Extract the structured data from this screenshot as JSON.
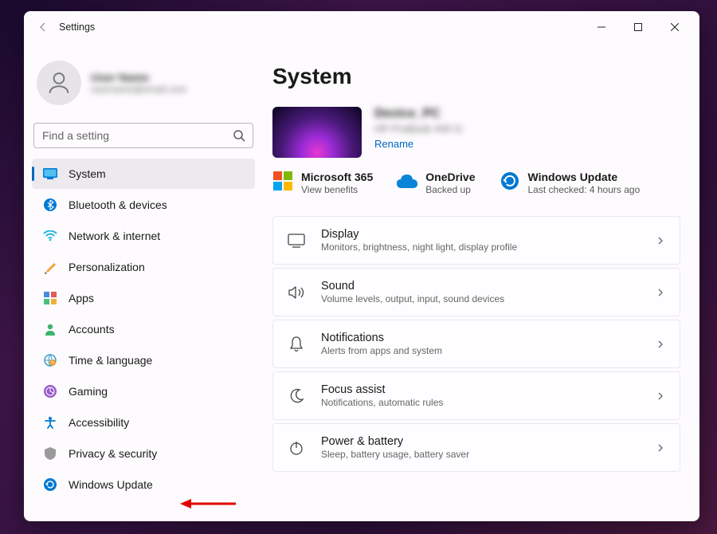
{
  "window": {
    "title": "Settings"
  },
  "user": {
    "name": "User Name",
    "email": "username@email.com"
  },
  "search": {
    "placeholder": "Find a setting"
  },
  "sidebar": {
    "items": [
      {
        "label": "System"
      },
      {
        "label": "Bluetooth & devices"
      },
      {
        "label": "Network & internet"
      },
      {
        "label": "Personalization"
      },
      {
        "label": "Apps"
      },
      {
        "label": "Accounts"
      },
      {
        "label": "Time & language"
      },
      {
        "label": "Gaming"
      },
      {
        "label": "Accessibility"
      },
      {
        "label": "Privacy & security"
      },
      {
        "label": "Windows Update"
      }
    ]
  },
  "page": {
    "title": "System",
    "device": {
      "name": "Device_PC",
      "model": "HP ProBook 440 G",
      "rename": "Rename"
    },
    "status": [
      {
        "title": "Microsoft 365",
        "sub": "View benefits"
      },
      {
        "title": "OneDrive",
        "sub": "Backed up"
      },
      {
        "title": "Windows Update",
        "sub": "Last checked: 4 hours ago"
      }
    ],
    "cards": [
      {
        "title": "Display",
        "sub": "Monitors, brightness, night light, display profile"
      },
      {
        "title": "Sound",
        "sub": "Volume levels, output, input, sound devices"
      },
      {
        "title": "Notifications",
        "sub": "Alerts from apps and system"
      },
      {
        "title": "Focus assist",
        "sub": "Notifications, automatic rules"
      },
      {
        "title": "Power & battery",
        "sub": "Sleep, battery usage, battery saver"
      }
    ]
  }
}
